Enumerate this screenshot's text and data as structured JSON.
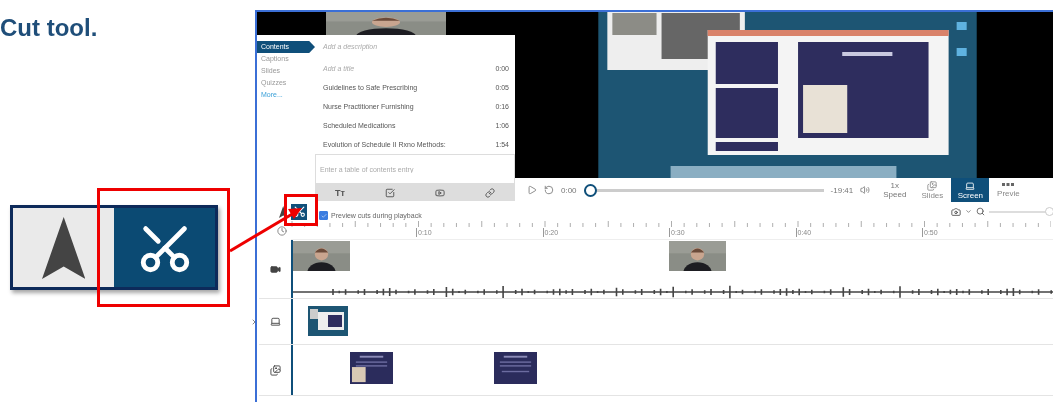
{
  "heading": "Cut tool.",
  "callout_tools": [
    {
      "kind": "select",
      "selected": false
    },
    {
      "kind": "cut",
      "selected": true
    }
  ],
  "editor": {
    "sidebar_tabs": [
      {
        "label": "Contents",
        "selected": true
      },
      {
        "label": "Captions",
        "selected": false
      },
      {
        "label": "Slides",
        "selected": false
      },
      {
        "label": "Quizzes",
        "selected": false
      }
    ],
    "more_link": "More...",
    "description_placeholder": "Add a description",
    "title_placeholder": "Add a title",
    "title_time": "0:00",
    "contents": [
      {
        "title": "Guidelines to Safe Prescribing",
        "time": "0:05"
      },
      {
        "title": "Nurse Practitioner Furnishing",
        "time": "0:16"
      },
      {
        "title": "Scheduled Medications",
        "time": "1:06"
      },
      {
        "title": "Evolution of Schedule II Rxno Methods:",
        "time": "1:54"
      }
    ],
    "entry_placeholder": "Enter a table of contents entry",
    "format_tool": "Tт",
    "player": {
      "position": "0:00",
      "remaining": "-19:41",
      "level": 0,
      "speed": "1x",
      "speed_label": "Speed"
    },
    "views": [
      {
        "label": "Slides",
        "kind": "slides",
        "selected": false
      },
      {
        "label": "Screen",
        "kind": "screen",
        "selected": true
      },
      {
        "label": "Previe",
        "kind": "preview",
        "selected": false
      }
    ],
    "tools": [
      {
        "kind": "select",
        "selected": false
      },
      {
        "kind": "cut",
        "selected": true
      }
    ],
    "preview_cuts": {
      "label": "Preview cuts during playback",
      "checked": true
    },
    "zoom": {
      "level": 1
    },
    "ruler_labels": [
      "0:10",
      "0:20",
      "0:30",
      "0:40",
      "0:50"
    ],
    "tracks": [
      {
        "kind": "camera"
      },
      {
        "kind": "screen"
      },
      {
        "kind": "slides"
      }
    ]
  }
}
